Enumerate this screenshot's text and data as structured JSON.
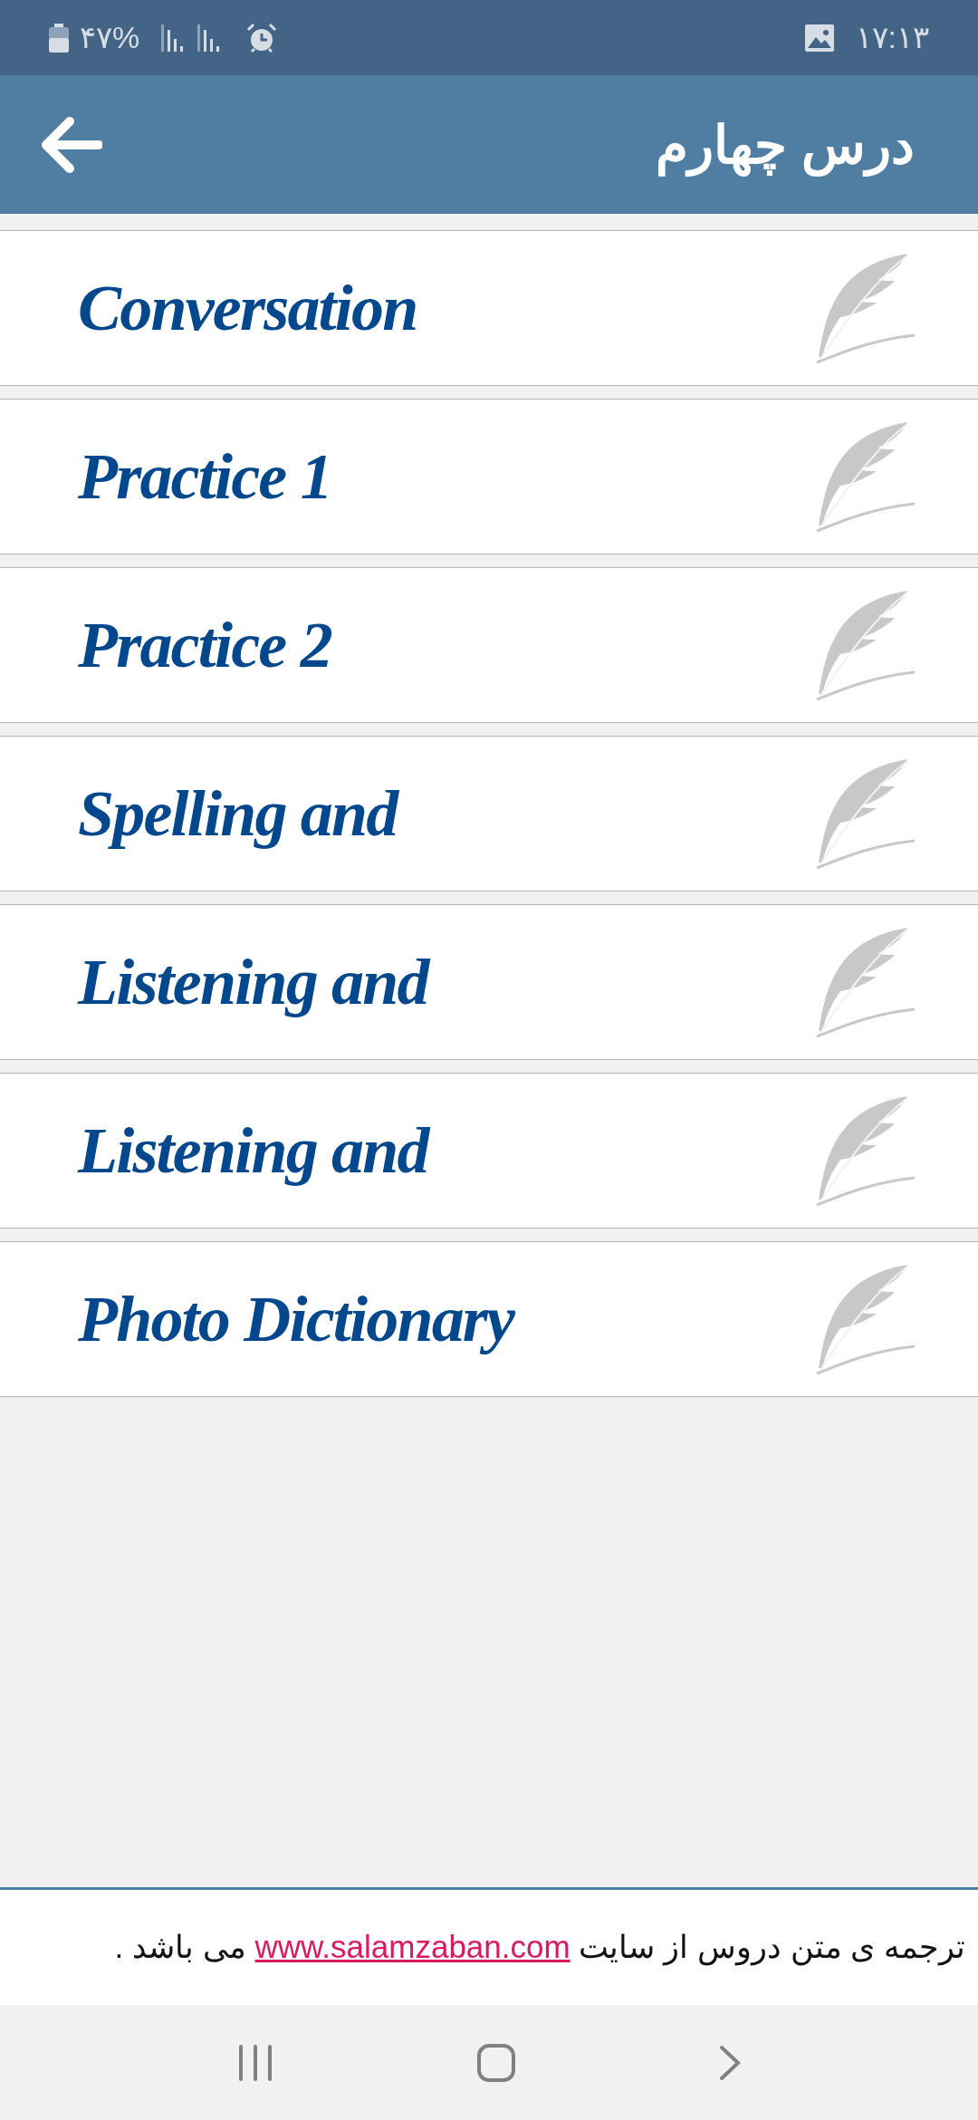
{
  "status_bar": {
    "time": "۱۷:۱۳",
    "battery": "۴۷%"
  },
  "header": {
    "title": "درس چهارم"
  },
  "items": [
    {
      "label": "Conversation"
    },
    {
      "label": "Practice 1"
    },
    {
      "label": "Practice 2"
    },
    {
      "label": "Spelling and"
    },
    {
      "label": "Listening and"
    },
    {
      "label": "Listening and"
    },
    {
      "label": "Photo Dictionary"
    }
  ],
  "footer": {
    "text_before": "ترجمه ی متن دروس از سایت",
    "link": "www.salamzaban.com",
    "text_after": "می باشد ."
  }
}
